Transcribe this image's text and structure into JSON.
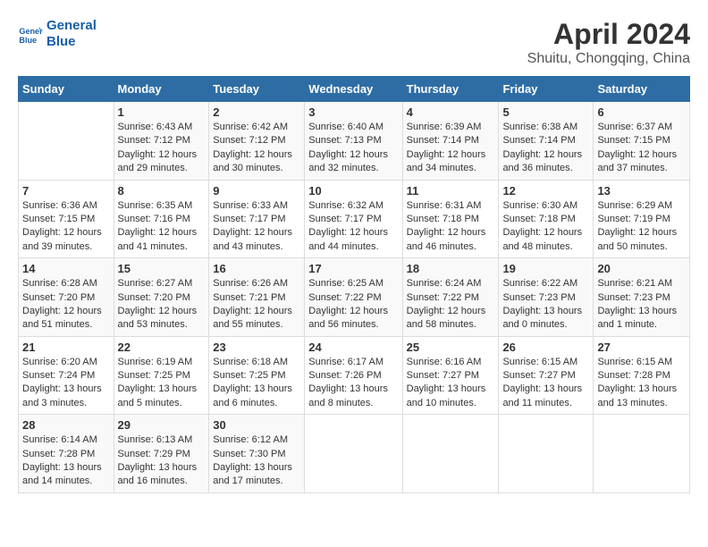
{
  "header": {
    "logo_line1": "General",
    "logo_line2": "Blue",
    "month": "April 2024",
    "location": "Shuitu, Chongqing, China"
  },
  "weekdays": [
    "Sunday",
    "Monday",
    "Tuesday",
    "Wednesday",
    "Thursday",
    "Friday",
    "Saturday"
  ],
  "weeks": [
    [
      {
        "day": "",
        "info": ""
      },
      {
        "day": "1",
        "info": "Sunrise: 6:43 AM\nSunset: 7:12 PM\nDaylight: 12 hours\nand 29 minutes."
      },
      {
        "day": "2",
        "info": "Sunrise: 6:42 AM\nSunset: 7:12 PM\nDaylight: 12 hours\nand 30 minutes."
      },
      {
        "day": "3",
        "info": "Sunrise: 6:40 AM\nSunset: 7:13 PM\nDaylight: 12 hours\nand 32 minutes."
      },
      {
        "day": "4",
        "info": "Sunrise: 6:39 AM\nSunset: 7:14 PM\nDaylight: 12 hours\nand 34 minutes."
      },
      {
        "day": "5",
        "info": "Sunrise: 6:38 AM\nSunset: 7:14 PM\nDaylight: 12 hours\nand 36 minutes."
      },
      {
        "day": "6",
        "info": "Sunrise: 6:37 AM\nSunset: 7:15 PM\nDaylight: 12 hours\nand 37 minutes."
      }
    ],
    [
      {
        "day": "7",
        "info": "Sunrise: 6:36 AM\nSunset: 7:15 PM\nDaylight: 12 hours\nand 39 minutes."
      },
      {
        "day": "8",
        "info": "Sunrise: 6:35 AM\nSunset: 7:16 PM\nDaylight: 12 hours\nand 41 minutes."
      },
      {
        "day": "9",
        "info": "Sunrise: 6:33 AM\nSunset: 7:17 PM\nDaylight: 12 hours\nand 43 minutes."
      },
      {
        "day": "10",
        "info": "Sunrise: 6:32 AM\nSunset: 7:17 PM\nDaylight: 12 hours\nand 44 minutes."
      },
      {
        "day": "11",
        "info": "Sunrise: 6:31 AM\nSunset: 7:18 PM\nDaylight: 12 hours\nand 46 minutes."
      },
      {
        "day": "12",
        "info": "Sunrise: 6:30 AM\nSunset: 7:18 PM\nDaylight: 12 hours\nand 48 minutes."
      },
      {
        "day": "13",
        "info": "Sunrise: 6:29 AM\nSunset: 7:19 PM\nDaylight: 12 hours\nand 50 minutes."
      }
    ],
    [
      {
        "day": "14",
        "info": "Sunrise: 6:28 AM\nSunset: 7:20 PM\nDaylight: 12 hours\nand 51 minutes."
      },
      {
        "day": "15",
        "info": "Sunrise: 6:27 AM\nSunset: 7:20 PM\nDaylight: 12 hours\nand 53 minutes."
      },
      {
        "day": "16",
        "info": "Sunrise: 6:26 AM\nSunset: 7:21 PM\nDaylight: 12 hours\nand 55 minutes."
      },
      {
        "day": "17",
        "info": "Sunrise: 6:25 AM\nSunset: 7:22 PM\nDaylight: 12 hours\nand 56 minutes."
      },
      {
        "day": "18",
        "info": "Sunrise: 6:24 AM\nSunset: 7:22 PM\nDaylight: 12 hours\nand 58 minutes."
      },
      {
        "day": "19",
        "info": "Sunrise: 6:22 AM\nSunset: 7:23 PM\nDaylight: 13 hours\nand 0 minutes."
      },
      {
        "day": "20",
        "info": "Sunrise: 6:21 AM\nSunset: 7:23 PM\nDaylight: 13 hours\nand 1 minute."
      }
    ],
    [
      {
        "day": "21",
        "info": "Sunrise: 6:20 AM\nSunset: 7:24 PM\nDaylight: 13 hours\nand 3 minutes."
      },
      {
        "day": "22",
        "info": "Sunrise: 6:19 AM\nSunset: 7:25 PM\nDaylight: 13 hours\nand 5 minutes."
      },
      {
        "day": "23",
        "info": "Sunrise: 6:18 AM\nSunset: 7:25 PM\nDaylight: 13 hours\nand 6 minutes."
      },
      {
        "day": "24",
        "info": "Sunrise: 6:17 AM\nSunset: 7:26 PM\nDaylight: 13 hours\nand 8 minutes."
      },
      {
        "day": "25",
        "info": "Sunrise: 6:16 AM\nSunset: 7:27 PM\nDaylight: 13 hours\nand 10 minutes."
      },
      {
        "day": "26",
        "info": "Sunrise: 6:15 AM\nSunset: 7:27 PM\nDaylight: 13 hours\nand 11 minutes."
      },
      {
        "day": "27",
        "info": "Sunrise: 6:15 AM\nSunset: 7:28 PM\nDaylight: 13 hours\nand 13 minutes."
      }
    ],
    [
      {
        "day": "28",
        "info": "Sunrise: 6:14 AM\nSunset: 7:28 PM\nDaylight: 13 hours\nand 14 minutes."
      },
      {
        "day": "29",
        "info": "Sunrise: 6:13 AM\nSunset: 7:29 PM\nDaylight: 13 hours\nand 16 minutes."
      },
      {
        "day": "30",
        "info": "Sunrise: 6:12 AM\nSunset: 7:30 PM\nDaylight: 13 hours\nand 17 minutes."
      },
      {
        "day": "",
        "info": ""
      },
      {
        "day": "",
        "info": ""
      },
      {
        "day": "",
        "info": ""
      },
      {
        "day": "",
        "info": ""
      }
    ]
  ]
}
